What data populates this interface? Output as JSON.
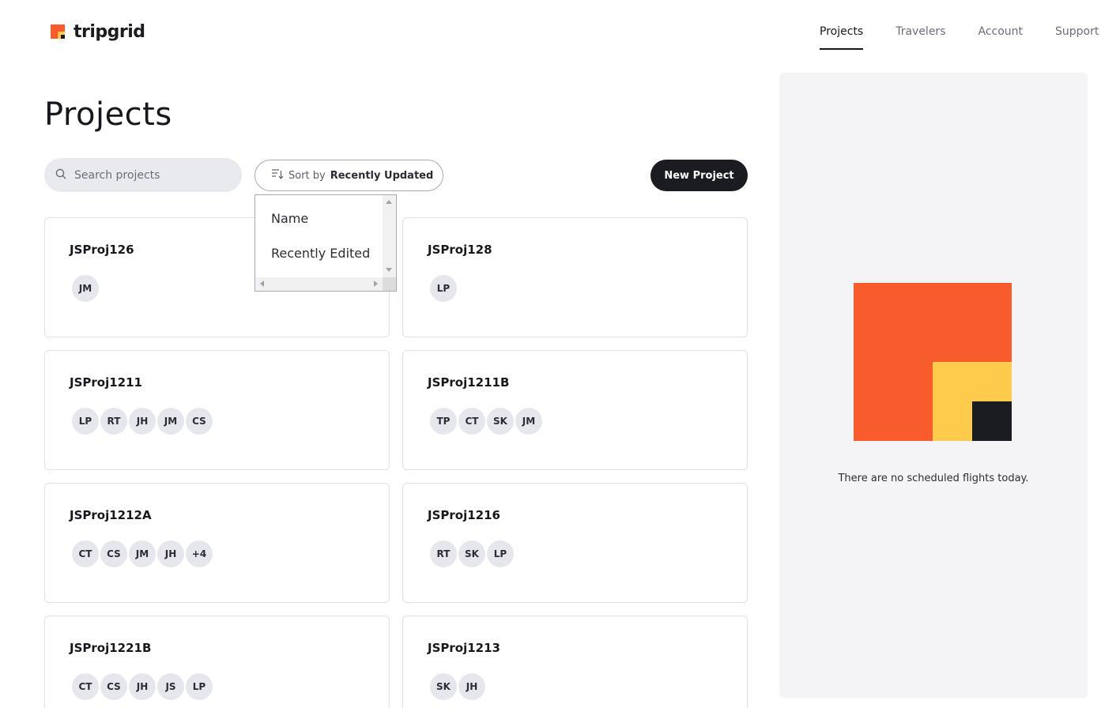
{
  "brand": {
    "name": "tripgrid"
  },
  "nav": [
    {
      "label": "Projects",
      "active": true
    },
    {
      "label": "Travelers",
      "active": false
    },
    {
      "label": "Account",
      "active": false
    },
    {
      "label": "Support",
      "active": false
    }
  ],
  "page": {
    "title": "Projects"
  },
  "search": {
    "placeholder": "Search projects",
    "value": ""
  },
  "sort": {
    "prefix": "Sort by",
    "value": "Recently Updated",
    "options": [
      "Name",
      "Recently Edited"
    ]
  },
  "toolbar": {
    "new_project_label": "New Project"
  },
  "projects": [
    {
      "name": "JSProj126",
      "members": [
        "JM"
      ]
    },
    {
      "name": "JSProj128",
      "members": [
        "LP"
      ]
    },
    {
      "name": "JSProj1211",
      "members": [
        "LP",
        "RT",
        "JH",
        "JM",
        "CS"
      ]
    },
    {
      "name": "JSProj1211B",
      "members": [
        "TP",
        "CT",
        "SK",
        "JM"
      ]
    },
    {
      "name": "JSProj1212A",
      "members": [
        "CT",
        "CS",
        "JM",
        "JH",
        "+4"
      ]
    },
    {
      "name": "JSProj1216",
      "members": [
        "RT",
        "SK",
        "LP"
      ]
    },
    {
      "name": "JSProj1221B",
      "members": [
        "CT",
        "CS",
        "JH",
        "JS",
        "LP"
      ]
    },
    {
      "name": "JSProj1213",
      "members": [
        "SK",
        "JH"
      ]
    }
  ],
  "flights": {
    "empty_message": "There are no scheduled flights today."
  },
  "colors": {
    "brand_orange": "#f85c2c",
    "brand_yellow": "#ffcb4d",
    "brand_dark": "#1b1c22"
  }
}
